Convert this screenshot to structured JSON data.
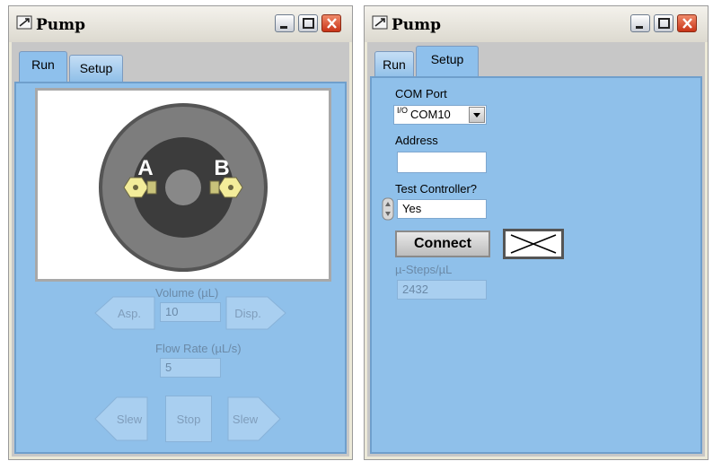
{
  "left_window": {
    "title": "Pump",
    "tabs": [
      {
        "label": "Run"
      },
      {
        "label": "Setup"
      }
    ],
    "active_tab": "Run",
    "valve": {
      "port_a": "A",
      "port_b": "B"
    },
    "volume": {
      "label": "Volume (µL)",
      "value": "10"
    },
    "asp_label": "Asp.",
    "disp_label": "Disp.",
    "flow_rate": {
      "label": "Flow Rate (µL/s)",
      "value": "5"
    },
    "slew_left_label": "Slew",
    "stop_label": "Stop",
    "slew_right_label": "Slew"
  },
  "right_window": {
    "title": "Pump",
    "tabs": [
      {
        "label": "Run"
      },
      {
        "label": "Setup"
      }
    ],
    "active_tab": "Setup",
    "com_port": {
      "label": "COM Port",
      "io_prefix": "I/O",
      "value": "COM10"
    },
    "address": {
      "label": "Address",
      "value": ""
    },
    "test_controller": {
      "label": "Test Controller?",
      "value": "Yes"
    },
    "connect_label": "Connect",
    "steps": {
      "label": "µ-Steps/µL",
      "value": "2432"
    }
  },
  "icons": [
    "pump-window-icon",
    "minimize-icon",
    "maximize-icon",
    "close-icon",
    "dropdown-arrow-icon",
    "spinner-icon",
    "connection-status-icon"
  ]
}
